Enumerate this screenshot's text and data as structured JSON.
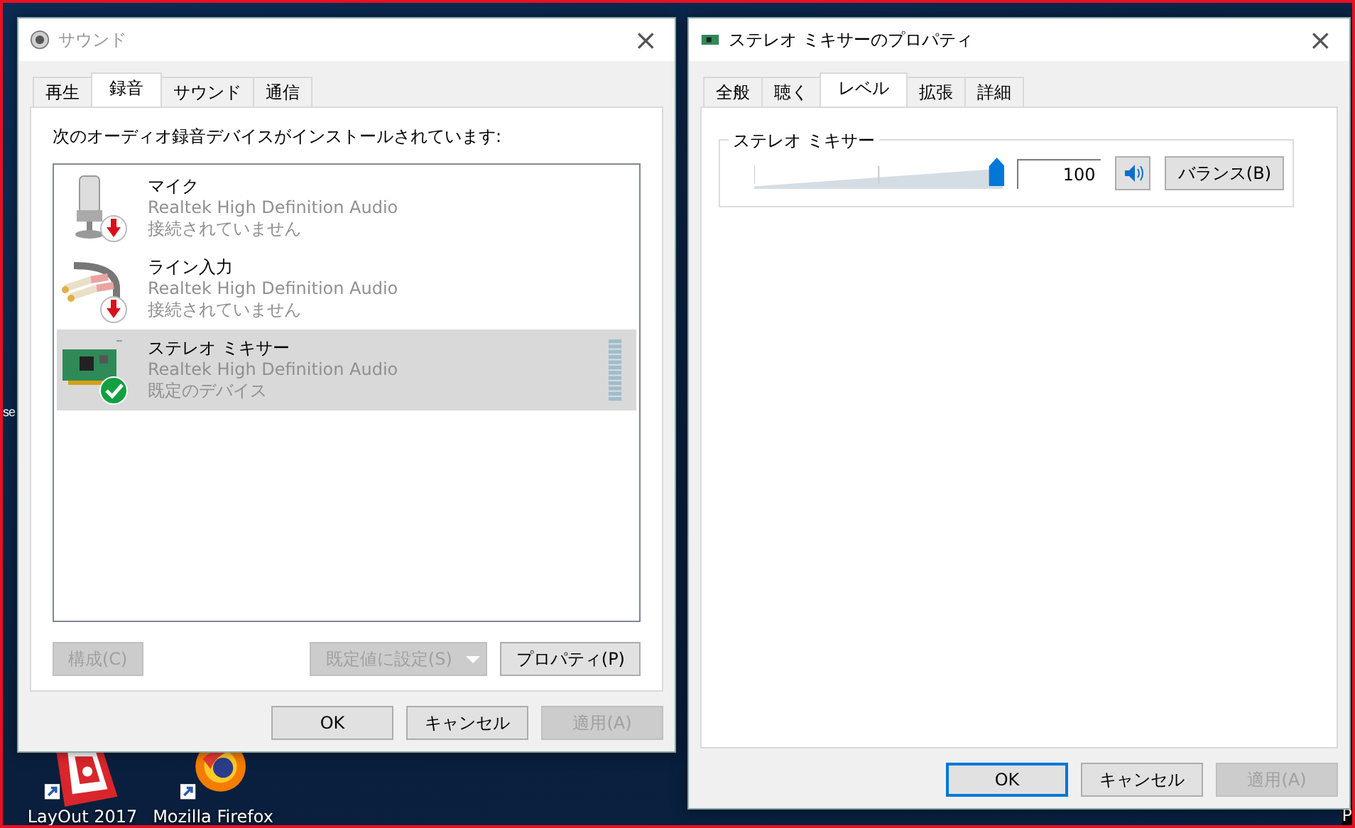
{
  "desktop": {
    "left_edge_text": "se",
    "right_edge_text": "P",
    "icons": [
      {
        "kind": "layout",
        "label": "LayOut 2017"
      },
      {
        "kind": "firefox",
        "label": "Mozilla Firefox"
      }
    ]
  },
  "sound_window": {
    "title": "サウンド",
    "close": "×",
    "tabs": [
      {
        "label": "再生",
        "selected": false
      },
      {
        "label": "録音",
        "selected": true
      },
      {
        "label": "サウンド",
        "selected": false
      },
      {
        "label": "通信",
        "selected": false
      }
    ],
    "instruction": "次のオーディオ録音デバイスがインストールされています:",
    "devices": [
      {
        "kind": "mic",
        "name": "マイク",
        "driver": "Realtek High Definition Audio",
        "status": "接続されていません",
        "badge": {
          "kind": "disconnected"
        },
        "selected": false,
        "meter": false
      },
      {
        "kind": "line",
        "name": "ライン入力",
        "driver": "Realtek High Definition Audio",
        "status": "接続されていません",
        "badge": {
          "kind": "disconnected"
        },
        "selected": false,
        "meter": false
      },
      {
        "kind": "board",
        "name": "ステレオ ミキサー",
        "driver": "Realtek High Definition Audio",
        "status": "既定のデバイス",
        "badge": {
          "kind": "default"
        },
        "selected": true,
        "meter": true
      }
    ],
    "panel_buttons": [
      {
        "label": "構成(C)",
        "disabled": true,
        "kind": "plain"
      },
      {
        "label": "既定値に設定(S)",
        "disabled": true,
        "kind": "split"
      },
      {
        "label": "プロパティ(P)",
        "disabled": false,
        "kind": "plain"
      }
    ],
    "buttons": [
      {
        "label": "OK",
        "disabled": false,
        "focused": false
      },
      {
        "label": "キャンセル",
        "disabled": false,
        "focused": false
      },
      {
        "label": "適用(A)",
        "disabled": true,
        "focused": false
      }
    ]
  },
  "properties_window": {
    "title": "ステレオ ミキサーのプロパティ",
    "close": "×",
    "tabs": [
      {
        "label": "全般",
        "selected": false
      },
      {
        "label": "聴く",
        "selected": false
      },
      {
        "label": "レベル",
        "selected": true
      },
      {
        "label": "拡張",
        "selected": false
      },
      {
        "label": "詳細",
        "selected": false
      }
    ],
    "group": {
      "title": "ステレオ ミキサー",
      "level": 1,
      "value": "100",
      "muted": false,
      "balance_button": "バランス(B)"
    },
    "buttons": [
      {
        "label": "OK",
        "disabled": false,
        "focused": true
      },
      {
        "label": "キャンセル",
        "disabled": false,
        "focused": false
      },
      {
        "label": "適用(A)",
        "disabled": true,
        "focused": false
      }
    ]
  }
}
